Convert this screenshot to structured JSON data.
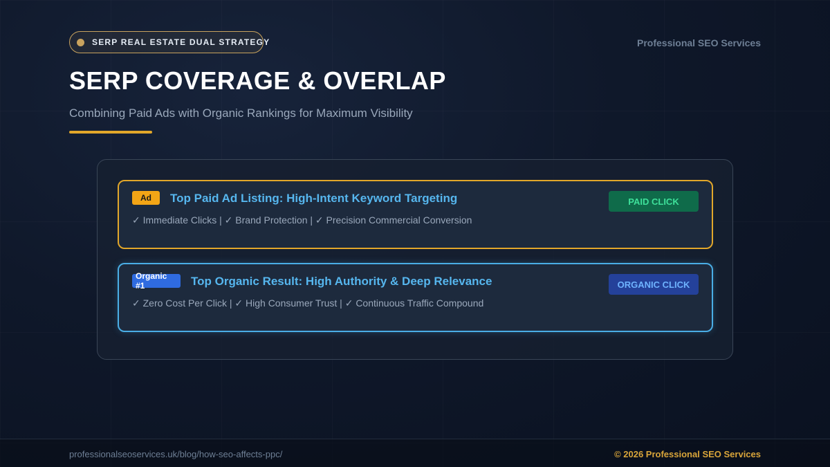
{
  "header": {
    "pill_label": "SERP REAL ESTATE DUAL STRATEGY",
    "brand": "Professional SEO Services",
    "title": "SERP COVERAGE & OVERLAP",
    "subtitle": "Combining Paid Ads with Organic Rankings for Maximum Visibility"
  },
  "cards": {
    "paid": {
      "badge": "Ad",
      "title": "Top Paid Ad Listing: High-Intent Keyword Targeting",
      "description": "✓ Immediate Clicks | ✓ Brand Protection | ✓ Precision Commercial Conversion",
      "button": "PAID CLICK"
    },
    "organic": {
      "badge": "Organic #1",
      "title": "Top Organic Result: High Authority & Deep Relevance",
      "description": "✓ Zero Cost Per Click | ✓ High Consumer Trust | ✓ Continuous Traffic Compound",
      "button": "ORGANIC CLICK"
    }
  },
  "footer": {
    "url": "professionalseoservices.uk/blog/how-seo-affects-ppc/",
    "copyright": "© 2026 Professional SEO Services"
  },
  "colors": {
    "accent_gold": "#e2a72a",
    "paid_border": "#e2a72a",
    "organic_border": "#4aaee6",
    "title_blue": "#56b6ee",
    "paid_button": "#0f6b4a",
    "organic_button": "#24419a"
  },
  "icons": {
    "pill_marker": "dot-icon"
  }
}
